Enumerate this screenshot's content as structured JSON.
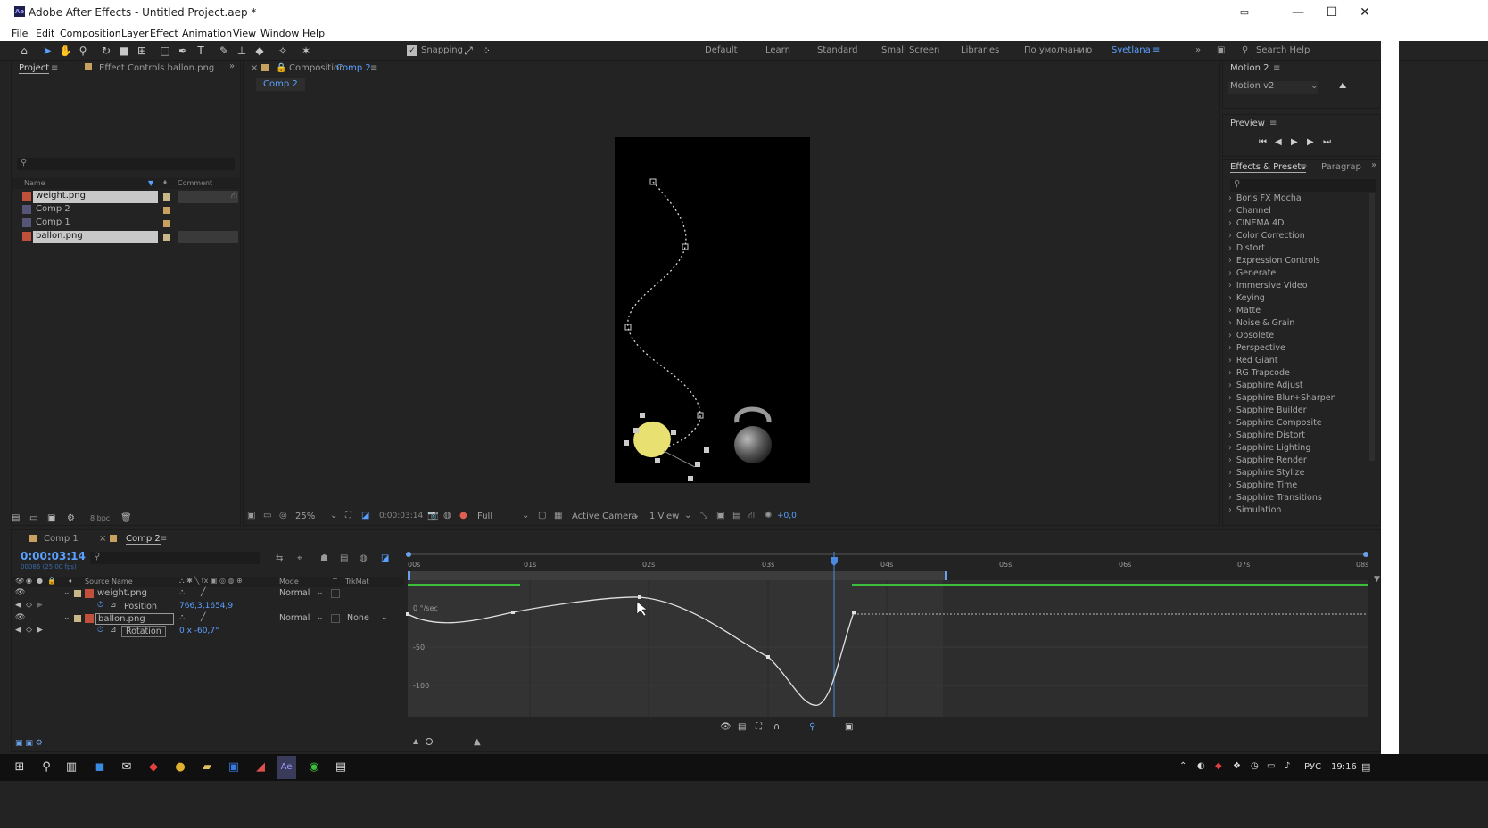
{
  "window": {
    "title": "Adobe After Effects - Untitled Project.aep *",
    "logo_text": "Ae"
  },
  "menu": [
    "File",
    "Edit",
    "Composition",
    "Layer",
    "Effect",
    "Animation",
    "View",
    "Window",
    "Help"
  ],
  "toolbar": {
    "snapping_label": "Snapping",
    "snapping_checked": true
  },
  "workspaces": [
    "Default",
    "Learn",
    "Standard",
    "Small Screen",
    "Libraries",
    "По умолчанию",
    "Svetlana"
  ],
  "active_workspace": "Svetlana",
  "search_help": "Search Help",
  "project_panel": {
    "tab": "Project",
    "effect_controls_tab": "Effect Controls ballon.png",
    "columns": {
      "name": "Name",
      "comment": "Comment"
    },
    "items": [
      {
        "name": "weight.png",
        "type": "image",
        "selected": true,
        "color": "#c8b888"
      },
      {
        "name": "Comp 2",
        "type": "comp",
        "selected": false,
        "color": "#c8a060"
      },
      {
        "name": "Comp 1",
        "type": "comp",
        "selected": false,
        "color": "#c8a060"
      },
      {
        "name": "ballon.png",
        "type": "image",
        "selected": true,
        "color": "#c8b888"
      }
    ],
    "bpc": "8 bpc"
  },
  "composition_panel": {
    "tab_prefix": "Composition",
    "tab_name": "Comp 2",
    "breadcrumb": "Comp 2",
    "zoom": "25%",
    "timecode": "0:00:03:14",
    "resolution": "Full",
    "camera": "Active Camera",
    "view": "1 View",
    "exposure": "+0,0"
  },
  "motion_panel": {
    "title": "Motion 2",
    "preset": "Motion v2"
  },
  "preview_panel": {
    "title": "Preview"
  },
  "effects_panel": {
    "tab": "Effects & Presets",
    "tab2": "Paragrap",
    "items": [
      "Boris FX Mocha",
      "Channel",
      "CINEMA 4D",
      "Color Correction",
      "Distort",
      "Expression Controls",
      "Generate",
      "Immersive Video",
      "Keying",
      "Matte",
      "Noise & Grain",
      "Obsolete",
      "Perspective",
      "Red Giant",
      "RG Trapcode",
      "Sapphire Adjust",
      "Sapphire Blur+Sharpen",
      "Sapphire Builder",
      "Sapphire Composite",
      "Sapphire Distort",
      "Sapphire Lighting",
      "Sapphire Render",
      "Sapphire Stylize",
      "Sapphire Time",
      "Sapphire Transitions",
      "Simulation"
    ]
  },
  "timeline": {
    "tabs": [
      "Comp 1",
      "Comp 2"
    ],
    "active_tab": "Comp 2",
    "timecode": "0:00:03:14",
    "frame_sub": "00086 (25.00 fps)",
    "columns": {
      "source": "Source Name",
      "mode": "Mode",
      "t": "T",
      "trkmat": "TrkMat"
    },
    "layers": [
      {
        "name": "weight.png",
        "mode": "Normal",
        "trkmat": "",
        "prop": "Position",
        "value": "766,3,1654,9"
      },
      {
        "name": "ballon.png",
        "mode": "Normal",
        "trkmat": "None",
        "prop": "Rotation",
        "value": "0 x -60,7°"
      }
    ],
    "ruler": [
      "00s",
      "01s",
      "02s",
      "03s",
      "04s",
      "05s",
      "06s",
      "07s",
      "08s"
    ],
    "graph_labels": [
      "0 °/sec",
      "-50",
      "-100"
    ]
  },
  "taskbar": {
    "lang": "РУС",
    "time": "19:16"
  },
  "colors": {
    "accent": "#5aa0ff",
    "workarea": "#6aa0e8",
    "green": "#3cbd3c",
    "balloon": "#e8e070"
  }
}
